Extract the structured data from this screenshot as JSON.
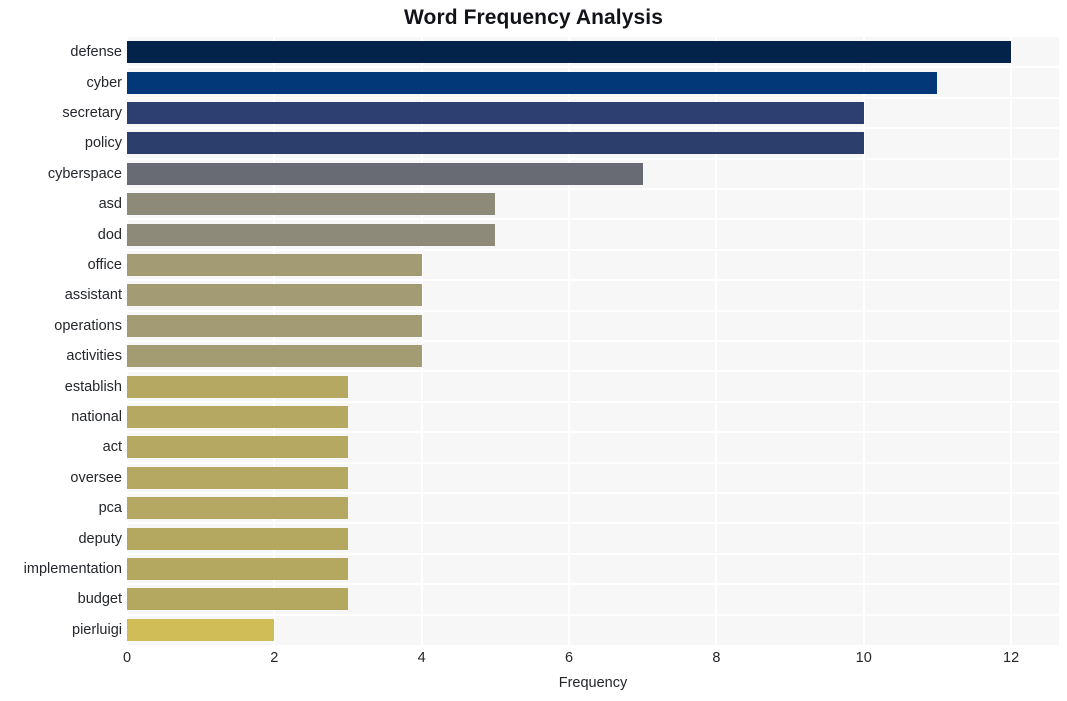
{
  "chart_data": {
    "type": "bar",
    "orientation": "horizontal",
    "title": "Word Frequency Analysis",
    "xlabel": "Frequency",
    "ylabel": "",
    "xlim": [
      0,
      12.65
    ],
    "xticks": [
      0,
      2,
      4,
      6,
      8,
      10,
      12
    ],
    "xtick_labels": [
      "0",
      "2",
      "4",
      "6",
      "8",
      "10",
      "12"
    ],
    "grid": true,
    "legend": null,
    "categories": [
      "defense",
      "cyber",
      "secretary",
      "policy",
      "cyberspace",
      "asd",
      "dod",
      "office",
      "assistant",
      "operations",
      "activities",
      "establish",
      "national",
      "act",
      "oversee",
      "pca",
      "deputy",
      "implementation",
      "budget",
      "pierluigi"
    ],
    "values": [
      12,
      11,
      10,
      10,
      7,
      5,
      5,
      4,
      4,
      4,
      4,
      3,
      3,
      3,
      3,
      3,
      3,
      3,
      3,
      2
    ],
    "bar_colors": [
      "#04234b",
      "#033878",
      "#2d3f70",
      "#2c3e6c",
      "#686b73",
      "#8e8a7a",
      "#8e8a79",
      "#a39b74",
      "#a39b73",
      "#a39b73",
      "#a39b72",
      "#b4a863",
      "#b4a863",
      "#b4a862",
      "#b4a862",
      "#b4a862",
      "#b4a861",
      "#b4a861",
      "#b4a861",
      "#d0bd57"
    ],
    "plot_background": "#f7f7f7",
    "grid_color": "#ffffff",
    "text_color": "#23262b",
    "title_color": "#111318"
  }
}
